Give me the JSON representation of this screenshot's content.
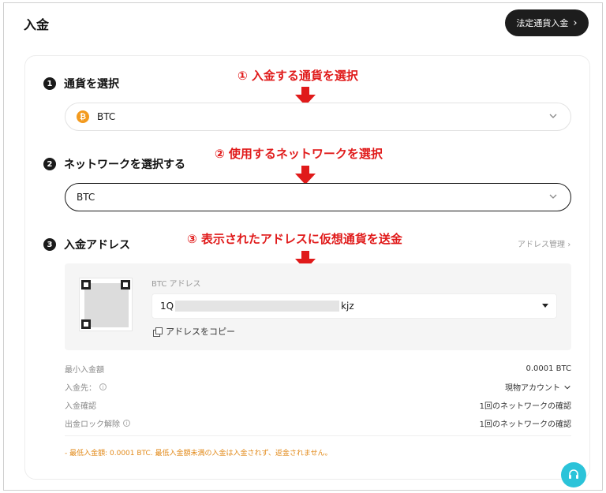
{
  "header": {
    "title": "入金",
    "fiat_button_label": "法定通貨入金"
  },
  "steps": [
    {
      "num": "1",
      "label": "通貨を選択"
    },
    {
      "num": "2",
      "label": "ネットワークを選択する"
    },
    {
      "num": "3",
      "label": "入金アドレス"
    }
  ],
  "annotations": [
    "① 入金する通貨を選択",
    "② 使用するネットワークを選択",
    "③ 表示されたアドレスに仮想通貨を送金"
  ],
  "currency_select": {
    "coin_glyph": "₿",
    "value": "BTC"
  },
  "network_select": {
    "value": "BTC"
  },
  "address": {
    "manage_link": "アドレス管理",
    "label": "BTC アドレス",
    "prefix": "1Q",
    "suffix": "kjz",
    "copy_label": "アドレスをコピー"
  },
  "info_rows": [
    {
      "label": "最小入金額",
      "value": "0.0001 BTC",
      "has_info": false,
      "has_dropdown": false
    },
    {
      "label": "入金先：",
      "value": "現物アカウント",
      "has_info": true,
      "has_dropdown": true
    },
    {
      "label": "入金確認",
      "value": "1回のネットワークの確認",
      "has_info": false,
      "has_dropdown": false
    },
    {
      "label": "出金ロック解除",
      "value": "1回のネットワークの確認",
      "has_info": true,
      "has_dropdown": false
    }
  ],
  "notice": "- 最低入金額: 0.0001 BTC. 最低入金額未満の入金は入金されず、返金されません。",
  "colors": {
    "accent_red": "#e01a1a",
    "btc_orange": "#f39a1e",
    "support_teal": "#2bc3d9",
    "notice_orange": "#e28a1a"
  }
}
